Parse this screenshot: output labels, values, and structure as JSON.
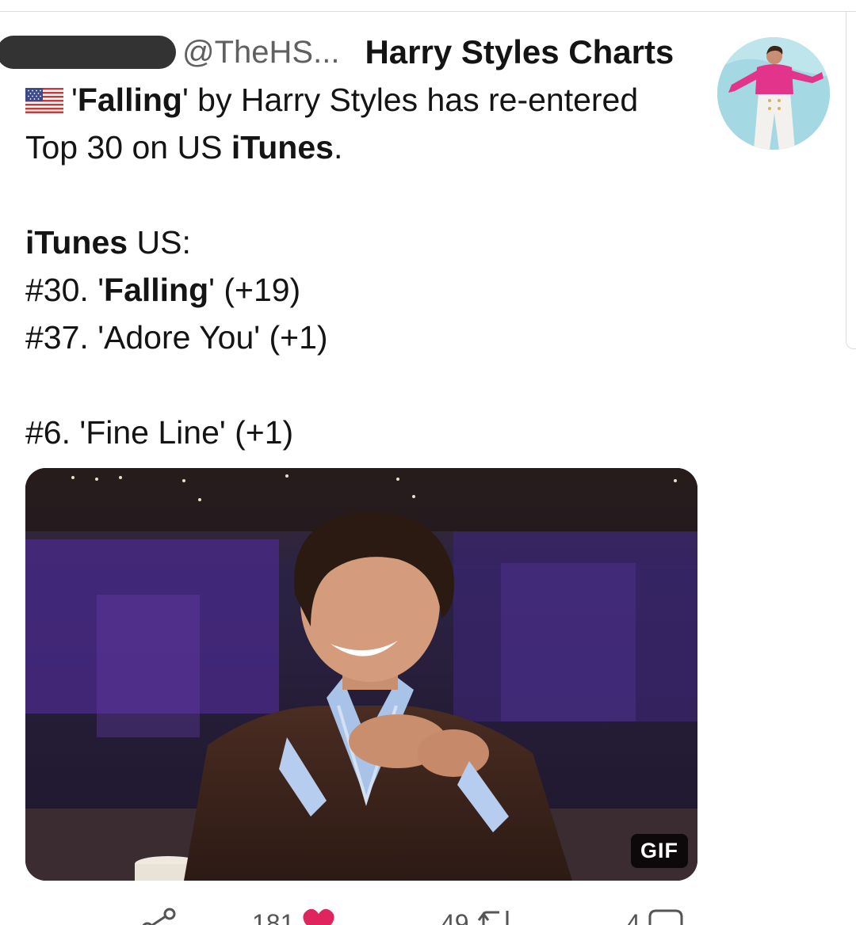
{
  "tweet": {
    "handle": "@TheHS...",
    "display_name": "Harry Styles Charts",
    "body": {
      "line1": {
        "flag_icon": "us-flag-icon",
        "quote_open": "'",
        "bold": "Falling",
        "rest": "' by Harry Styles has re-entered"
      },
      "line2": {
        "pre": "Top 30 on US ",
        "bold": "iTunes",
        "post": "."
      },
      "list_heading": {
        "bold": "iTunes",
        "rest": " US:"
      },
      "items": [
        {
          "prefix": "#30. '",
          "bold": "Falling",
          "suffix": "' (+19)"
        },
        {
          "prefix": "#37. 'Adore You' (+1)",
          "bold": "",
          "suffix": ""
        }
      ],
      "album_line": "#6. 'Fine Line' (+1)"
    },
    "media": {
      "badge": "GIF"
    },
    "actions": {
      "share_icon": "share-icon",
      "likes": "181",
      "like_icon": "heart-icon",
      "retweets": "49",
      "retweet_icon": "retweet-icon",
      "replies": "4",
      "reply_icon": "reply-icon"
    },
    "colors": {
      "like": "#e0245e",
      "muted": "#606060"
    }
  }
}
